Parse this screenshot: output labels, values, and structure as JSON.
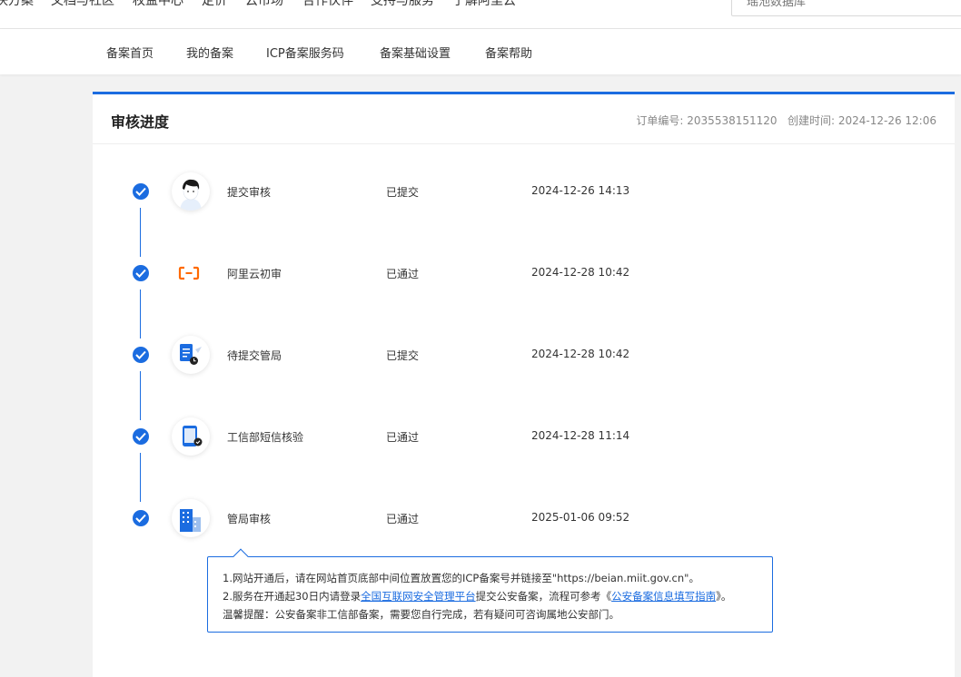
{
  "top_nav": {
    "items": [
      "决方案",
      "文档与社区",
      "权益中心",
      "定价",
      "云市场",
      "合作伙伴",
      "支持与服务",
      "了解阿里云"
    ],
    "search_placeholder": "瑶池数据库"
  },
  "sub_nav": {
    "tabs": [
      "备案首页",
      "我的备案",
      "ICP备案服务码",
      "备案基础设置",
      "备案帮助"
    ]
  },
  "card": {
    "title": "审核进度",
    "order_label": "订单编号: 2035538151120",
    "created_label": "创建时间: 2024-12-26 12:06"
  },
  "steps": [
    {
      "name": "提交审核",
      "status": "已提交",
      "time": "2024-12-26 14:13",
      "icon": "avatar-icon"
    },
    {
      "name": "阿里云初审",
      "status": "已通过",
      "time": "2024-12-28 10:42",
      "icon": "aliyun-logo-icon"
    },
    {
      "name": "待提交管局",
      "status": "已提交",
      "time": "2024-12-28 10:42",
      "icon": "document-clock-icon"
    },
    {
      "name": "工信部短信核验",
      "status": "已通过",
      "time": "2024-12-28 11:14",
      "icon": "phone-check-icon"
    },
    {
      "name": "管局审核",
      "status": "已通过",
      "time": "2025-01-06 09:52",
      "icon": "building-icon"
    }
  ],
  "notice": {
    "line1": "1.网站开通后，请在网站首页底部中间位置放置您的ICP备案号并链接至\"https://beian.miit.gov.cn\"。",
    "line2_pre": "2.服务在开通起30日内请登录",
    "line2_link1": "全国互联网安全管理平台",
    "line2_mid": "提交公安备案，流程可参考《",
    "line2_link2": "公安备案信息填写指南",
    "line2_post": "》。",
    "line3": "温馨提醒：公安备案非工信部备案，需要您自行完成，若有疑问可咨询属地公安部门。"
  },
  "colors": {
    "accent": "#1b6ce0",
    "aliyun_orange": "#ff6a00"
  }
}
